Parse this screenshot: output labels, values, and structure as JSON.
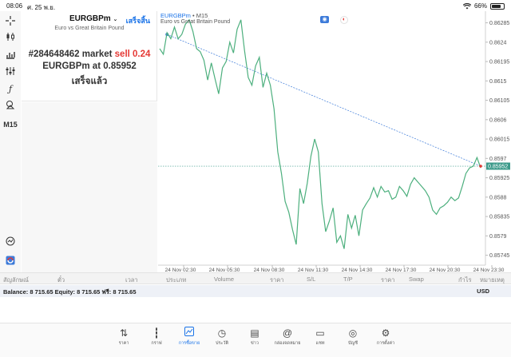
{
  "status_bar": {
    "time": "08:06",
    "date": "ศ. 25 พ.ย.",
    "battery": "66%"
  },
  "left_toolbar": {
    "timeframe_label": "M15",
    "icons": [
      "crosshair-icon",
      "candlestick-icon",
      "bar-chart-icon",
      "indicator-icon",
      "function-icon",
      "objects-icon",
      "timeframe-button",
      "trade-icon",
      "tradingview-icon"
    ]
  },
  "order_panel": {
    "symbol": "EURGBPm",
    "done_label": "เสร็จสิ้น",
    "description": "Euro vs Great Britain Pound",
    "result_prefix": "#284648462 market ",
    "result_side": "sell 0.24",
    "result_line2": "EURGBPm at ",
    "result_price": "0.85952",
    "result_status": "เสร็จแล้ว"
  },
  "chart_header": {
    "symbol": "EURGBPm",
    "timeframe": " • M15",
    "description": "Euro vs Great Britain Pound"
  },
  "chart_data": {
    "type": "line",
    "title": "",
    "xlabel": "",
    "ylabel": "",
    "x_ticks": [
      "24 Nov 02:30",
      "24 Nov 05:30",
      "24 Nov 08:30",
      "24 Nov 11:30",
      "24 Nov 14:30",
      "24 Nov 17:30",
      "24 Nov 20:30",
      "24 Nov 23:30"
    ],
    "y_ticks": [
      0.86285,
      0.8624,
      0.86195,
      0.8615,
      0.86105,
      0.8606,
      0.86015,
      0.8597,
      0.85925,
      0.8588,
      0.85835,
      0.8579,
      0.85745
    ],
    "ylim": [
      0.85722,
      0.86312
    ],
    "current_price": "0.85952",
    "current_price_value": 0.85952,
    "series": [
      {
        "values": [
          0.86225,
          0.86212,
          0.86262,
          0.86248,
          0.86275,
          0.86248,
          0.86258,
          0.86282,
          0.86292,
          0.86265,
          0.86225,
          0.86218,
          0.86198,
          0.86152,
          0.86192,
          0.86155,
          0.8612,
          0.8618,
          0.86195,
          0.8624,
          0.86215,
          0.8627,
          0.86292,
          0.8622,
          0.86158,
          0.8614,
          0.86185,
          0.86205,
          0.86135,
          0.86168,
          0.8614,
          0.86085,
          0.85985,
          0.85935,
          0.8587,
          0.85845,
          0.85805,
          0.8577,
          0.859,
          0.85865,
          0.85912,
          0.85975,
          0.86015,
          0.85985,
          0.85865,
          0.858,
          0.85825,
          0.85855,
          0.85775,
          0.8579,
          0.8576,
          0.8584,
          0.85808,
          0.85838,
          0.8579,
          0.8585,
          0.85865,
          0.85878,
          0.85902,
          0.8588,
          0.85905,
          0.85892,
          0.85895,
          0.85875,
          0.8588,
          0.85905,
          0.85895,
          0.85882,
          0.8591,
          0.85925,
          0.85915,
          0.85905,
          0.85895,
          0.8588,
          0.8585,
          0.8584,
          0.85855,
          0.8586,
          0.85868,
          0.8588,
          0.85872,
          0.85878,
          0.85905,
          0.85935,
          0.85948,
          0.85952,
          0.85972,
          0.85948
        ]
      }
    ],
    "trendline": {
      "start": {
        "index": 2,
        "value": 0.86258
      },
      "end": {
        "index": 87,
        "value": 0.85952
      }
    }
  },
  "table_header": {
    "columns": [
      "สัญลักษณ์",
      "ตั๋ว",
      "เวลา",
      "ประเภท",
      "Volume",
      "ราคา",
      "S/L",
      "T/P",
      "ราคา",
      "Swap",
      "กำไร",
      "หมายเหตุ"
    ]
  },
  "balance": {
    "text": "Balance: 8 715.65 Equity: 8 715.65 ฟรี: 8 715.65",
    "currency": "USD"
  },
  "bottom_nav": {
    "items": [
      {
        "label": "ราคา",
        "icon": "quotes-icon"
      },
      {
        "label": "กราฟ",
        "icon": "chart-icon"
      },
      {
        "label": "การซื้อขาย",
        "icon": "trade-icon",
        "active": true
      },
      {
        "label": "ประวัติ",
        "icon": "history-icon"
      },
      {
        "label": "ข่าว",
        "icon": "news-icon"
      },
      {
        "label": "กล่องจดหมาย",
        "icon": "mailbox-icon"
      },
      {
        "label": "แชท",
        "icon": "chat-icon"
      },
      {
        "label": "บัญชี",
        "icon": "account-icon"
      },
      {
        "label": "การตั้งค่า",
        "icon": "settings-icon"
      }
    ]
  }
}
